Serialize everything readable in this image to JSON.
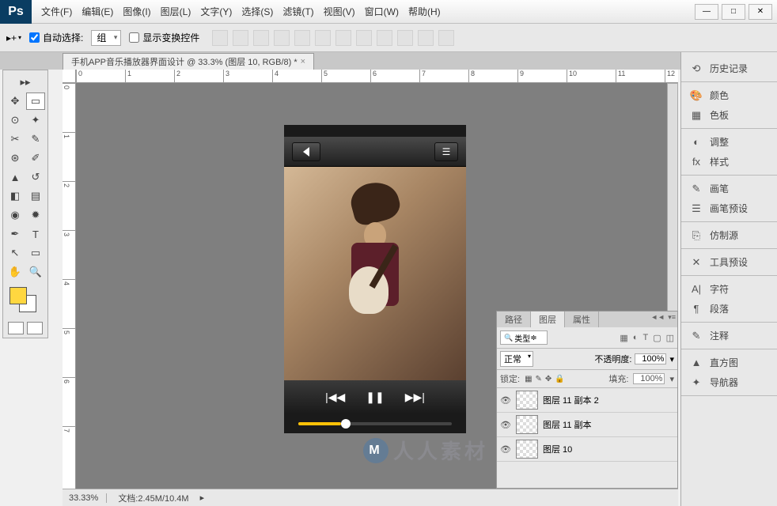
{
  "app": {
    "logo": "Ps"
  },
  "menu": {
    "items": [
      "文件(F)",
      "编辑(E)",
      "图像(I)",
      "图层(L)",
      "文字(Y)",
      "选择(S)",
      "滤镜(T)",
      "视图(V)",
      "窗口(W)",
      "帮助(H)"
    ]
  },
  "toolbar": {
    "auto_select": "自动选择:",
    "group": "组",
    "show_transform": "显示变换控件"
  },
  "document": {
    "tab_title": "手机APP音乐播放器界面设计 @ 33.3% (图层 10, RGB/8) *"
  },
  "rulers": {
    "h": [
      "0",
      "1",
      "2",
      "3",
      "4",
      "5",
      "6",
      "7",
      "8",
      "9",
      "10",
      "11",
      "12"
    ],
    "v": [
      "0",
      "1",
      "2",
      "3",
      "4",
      "5",
      "6",
      "7"
    ]
  },
  "layers_panel": {
    "tabs": [
      "路径",
      "图层",
      "属性"
    ],
    "search_label": "类型",
    "blend_mode": "正常",
    "opacity_label": "不透明度:",
    "opacity_value": "100%",
    "lock_label": "锁定:",
    "fill_label": "填充:",
    "fill_value": "100%",
    "layers": [
      {
        "name": "图层 11 副本 2"
      },
      {
        "name": "图层 11 副本"
      },
      {
        "name": "图层 10"
      }
    ]
  },
  "right_dock": {
    "groups": [
      [
        {
          "icon": "⟲",
          "label": "历史记录"
        }
      ],
      [
        {
          "icon": "🎨",
          "label": "颜色"
        },
        {
          "icon": "▦",
          "label": "色板"
        }
      ],
      [
        {
          "icon": "◐",
          "label": "调整"
        },
        {
          "icon": "fx",
          "label": "样式"
        }
      ],
      [
        {
          "icon": "✎",
          "label": "画笔"
        },
        {
          "icon": "☰",
          "label": "画笔预设"
        }
      ],
      [
        {
          "icon": "⎘",
          "label": "仿制源"
        }
      ],
      [
        {
          "icon": "✕",
          "label": "工具预设"
        }
      ],
      [
        {
          "icon": "A|",
          "label": "字符"
        },
        {
          "icon": "¶",
          "label": "段落"
        }
      ],
      [
        {
          "icon": "✎",
          "label": "注释"
        }
      ],
      [
        {
          "icon": "▲",
          "label": "直方图"
        },
        {
          "icon": "✦",
          "label": "导航器"
        }
      ]
    ]
  },
  "status": {
    "zoom": "33.33%",
    "doc_label": "文档:",
    "doc_size": "2.45M/10.4M"
  },
  "watermark": {
    "text": "人人素材",
    "logo": "M"
  },
  "colors": {
    "foreground": "#ffd740",
    "background": "#ffffff"
  }
}
